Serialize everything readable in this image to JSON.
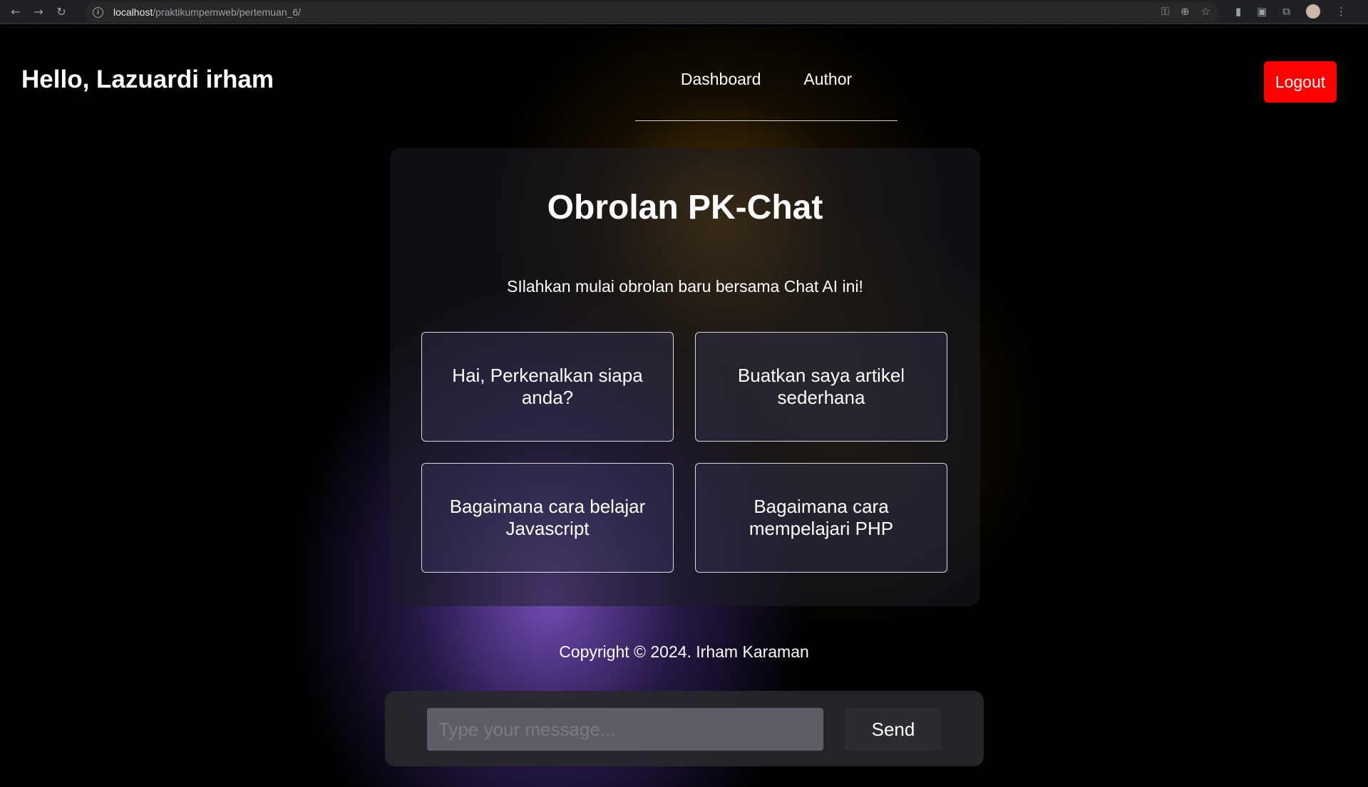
{
  "browser": {
    "url_host": "localhost",
    "url_path": "/praktikumpemweb/pertemuan_6/",
    "icons": {
      "back": "arrow-left-icon",
      "forward": "arrow-right-icon",
      "reload": "reload-icon",
      "site_info": "info-icon",
      "password": "key-icon",
      "zoom": "zoom-icon",
      "bookmark": "star-icon",
      "extensions": "puzzle-icon",
      "menu": "kebab-menu-icon"
    }
  },
  "header": {
    "greeting": "Hello, Lazuardi irham",
    "nav": [
      "Dashboard",
      "Author"
    ],
    "logout_label": "Logout"
  },
  "chat": {
    "title": "Obrolan PK-Chat",
    "subtitle": "SIlahkan mulai obrolan baru bersama Chat AI ini!",
    "suggestions": [
      "Hai, Perkenalkan siapa anda?",
      "Buatkan saya artikel sederhana",
      "Bagaimana cara belajar Javascript",
      "Bagaimana cara mempelajari PHP"
    ]
  },
  "footer": {
    "copyright": "Copyright © 2024. Irham Karaman"
  },
  "composer": {
    "placeholder": "Type your message...",
    "value": "",
    "send_label": "Send"
  },
  "colors": {
    "logout_bg": "#ff0000",
    "page_bg": "#000000",
    "glow_purple": "#7850be",
    "glow_amber": "#784e0a"
  }
}
